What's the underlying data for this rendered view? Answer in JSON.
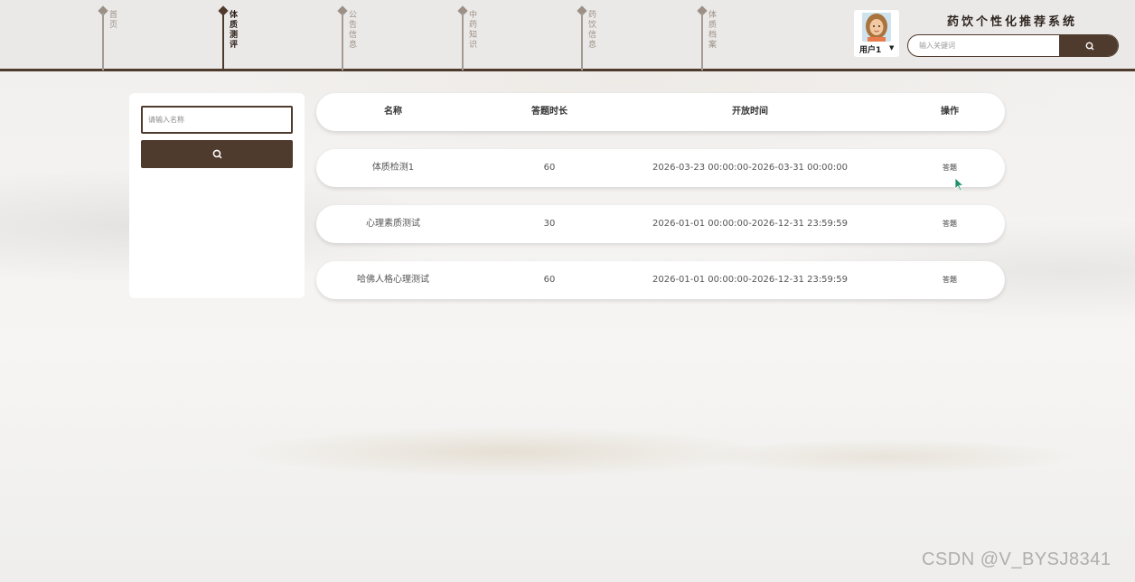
{
  "nav": {
    "items": [
      {
        "label": "首页",
        "active": false
      },
      {
        "label": "体质测评",
        "active": true
      },
      {
        "label": "公告信息",
        "active": false
      },
      {
        "label": "中药知识",
        "active": false
      },
      {
        "label": "药饮信息",
        "active": false
      },
      {
        "label": "体质档案",
        "active": false
      }
    ]
  },
  "header": {
    "system_title": "药饮个性化推荐系统",
    "user_name": "用户1",
    "search_placeholder": "输入关键词"
  },
  "sidebar": {
    "name_placeholder": "请输入名称"
  },
  "table": {
    "columns": [
      "名称",
      "答题时长",
      "开放时间",
      "操作"
    ],
    "rows": [
      {
        "name": "体质检测1",
        "duration": "60",
        "open_time": "2026-03-23 00:00:00-2026-03-31 00:00:00",
        "action": "答题"
      },
      {
        "name": "心理素质测试",
        "duration": "30",
        "open_time": "2026-01-01 00:00:00-2026-12-31 23:59:59",
        "action": "答题"
      },
      {
        "name": "哈佛人格心理测试",
        "duration": "60",
        "open_time": "2026-01-01 00:00:00-2026-12-31 23:59:59",
        "action": "答题"
      }
    ]
  },
  "watermark": "CSDN @V_BYSJ8341",
  "colors": {
    "accent": "#4f3a2e",
    "header_bg": "#ebe9e7"
  }
}
